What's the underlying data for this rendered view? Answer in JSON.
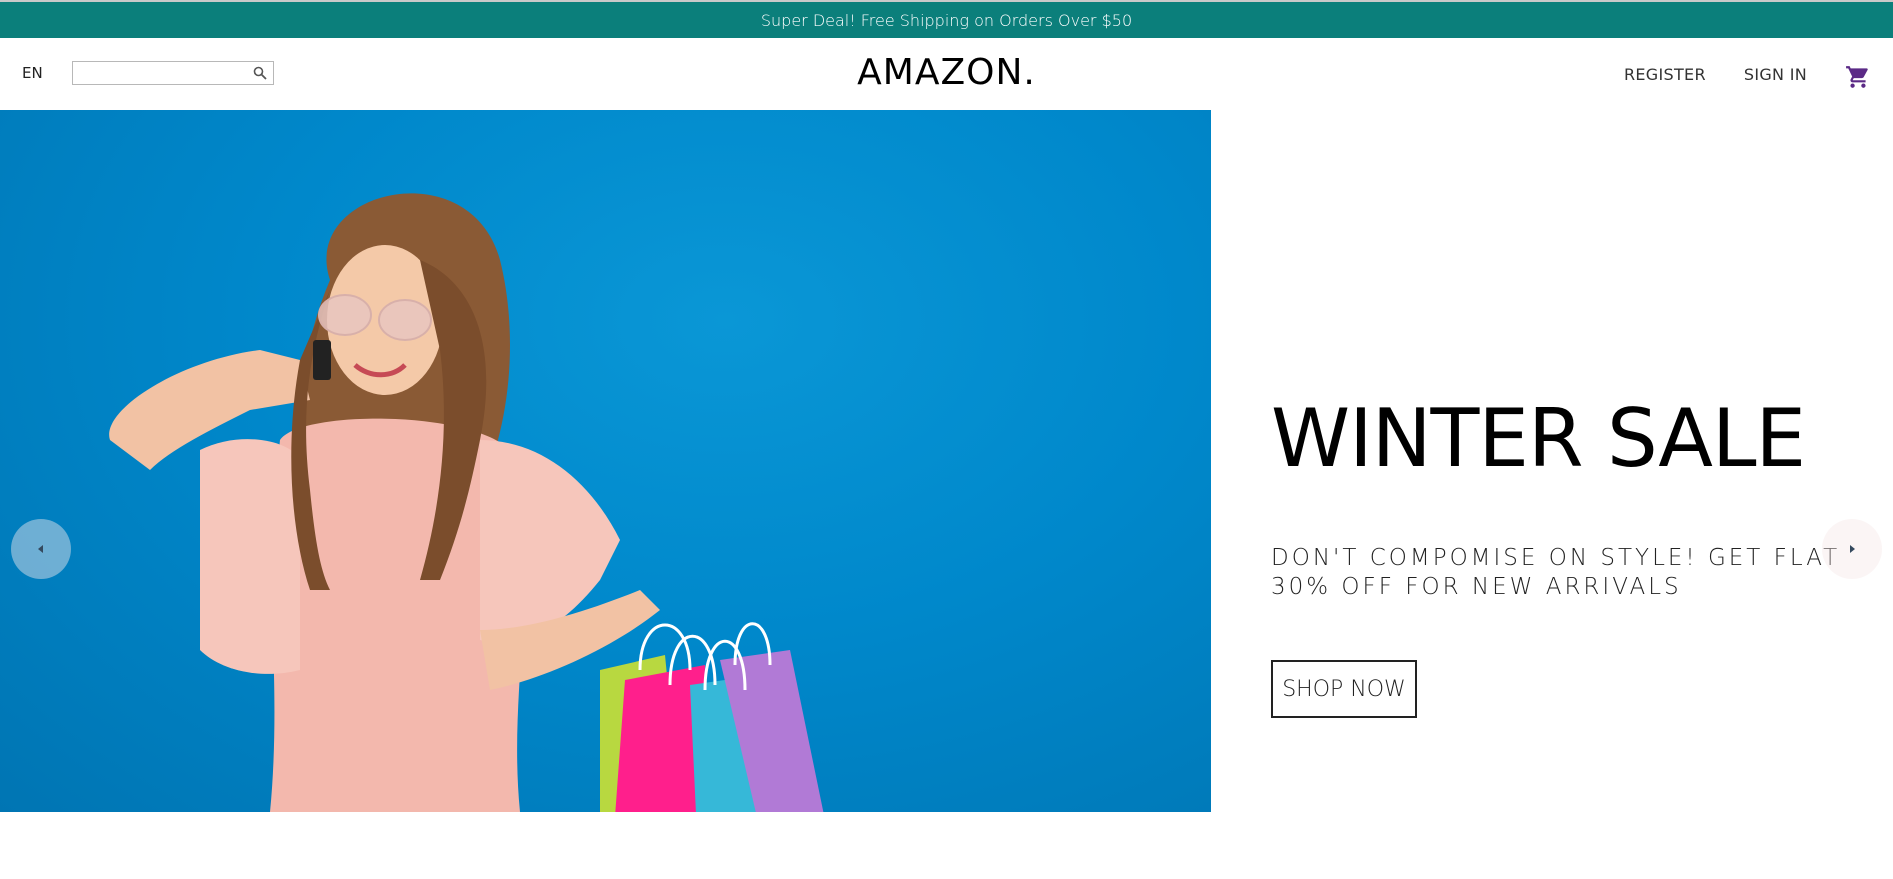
{
  "announcement": {
    "text": "Super Deal! Free Shipping on Orders Over $50"
  },
  "header": {
    "language": "EN",
    "search": {
      "value": "",
      "placeholder": ""
    },
    "logo": "AMAZON.",
    "links": {
      "register": "REGISTER",
      "sign_in": "SIGN IN"
    },
    "cart_icon": "shopping-cart-icon"
  },
  "slider": {
    "active_slide": {
      "title": "WINTER SALE",
      "description": "DON'T COMPOMISE ON STYLE! GET FLAT 30% OFF FOR NEW ARRIVALS",
      "button_label": "SHOP NOW",
      "image_subject": "woman in pink dress holding shopping bags on blue background"
    },
    "prev_icon": "arrow-left-icon",
    "next_icon": "arrow-right-icon"
  },
  "colors": {
    "announcement_bg": "#0b7f7b",
    "hero_bg": "#0088cb",
    "cart_icon": "#5b2a86"
  }
}
